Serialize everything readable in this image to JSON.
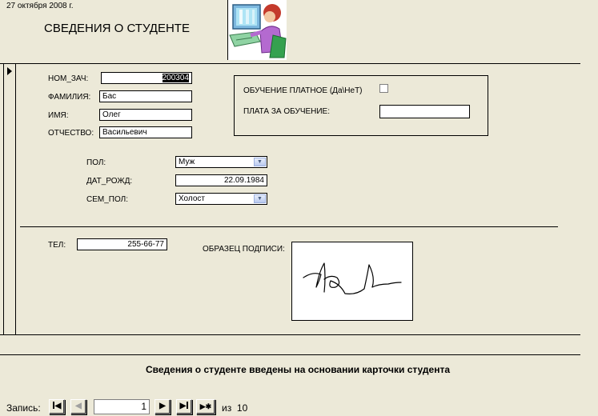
{
  "header": {
    "date": "27 октября 2008 г.",
    "title": "СВЕДЕНИЯ О СТУДЕНТЕ"
  },
  "record": {
    "num_zach_label": "НОМ_ЗАЧ:",
    "num_zach_value": "200304",
    "familiya_label": "ФАМИЛИЯ:",
    "familiya_value": "Бас",
    "imya_label": "ИМЯ:",
    "imya_value": "Олег",
    "otchestvo_label": "ОТЧЕСТВО:",
    "otchestvo_value": "Васильевич",
    "paid_label": "ОБУЧЕНИЕ ПЛАТНОЕ (Да\\НеТ)",
    "fee_label": "ПЛАТА ЗА ОБУЧЕНИЕ:",
    "fee_value": "",
    "pol_label": "ПОЛ:",
    "pol_value": "Муж",
    "dob_label": "ДАТ_РОЖД:",
    "dob_value": "22.09.1984",
    "sem_label": "СЕМ_ПОЛ:",
    "sem_value": "Холост",
    "tel_label": "ТЕЛ:",
    "tel_value": "255-66-77",
    "signature_label": "ОБРАЗЕЦ ПОДПИСИ:"
  },
  "footer": {
    "note": "Сведения о студенте введены на основании карточки студента"
  },
  "navigation": {
    "record_label": "Запись:",
    "current": "1",
    "of_label": "из",
    "total": "10",
    "first_glyph": "◀",
    "prev_glyph": "◀",
    "next_glyph": "▶",
    "last_glyph": "▶",
    "new_glyph": "▶✱"
  },
  "colors": {
    "form_background": "#ece9d8",
    "field_background": "#ffffff",
    "selection": "#000000"
  },
  "icons": [
    "record-selector-arrow-icon",
    "student-computer-icon",
    "dropdown-arrow-icon",
    "signature-image"
  ]
}
